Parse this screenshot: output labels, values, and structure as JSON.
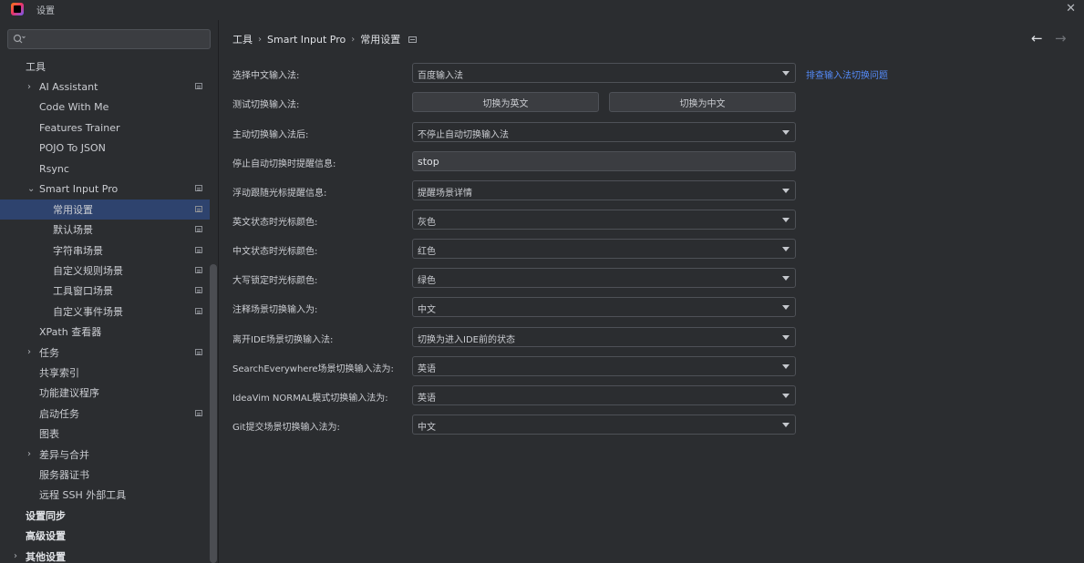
{
  "window": {
    "title": "设置",
    "close_label": "✕"
  },
  "search": {
    "value": "",
    "placeholder": ""
  },
  "sidebar": {
    "items": [
      {
        "label": "工具",
        "level": 0,
        "bold": false,
        "arrow": "",
        "icon": false,
        "selected": false
      },
      {
        "label": "AI Assistant",
        "level": 1,
        "arrow": "›",
        "icon": true,
        "selected": false
      },
      {
        "label": "Code With Me",
        "level": 1,
        "arrow": "",
        "icon": false,
        "selected": false
      },
      {
        "label": "Features Trainer",
        "level": 1,
        "arrow": "",
        "icon": false,
        "selected": false
      },
      {
        "label": "POJO To JSON",
        "level": 1,
        "arrow": "",
        "icon": false,
        "selected": false
      },
      {
        "label": "Rsync",
        "level": 1,
        "arrow": "",
        "icon": false,
        "selected": false
      },
      {
        "label": "Smart Input Pro",
        "level": 1,
        "arrow": "⌄",
        "icon": true,
        "selected": false
      },
      {
        "label": "常用设置",
        "level": 2,
        "arrow": "",
        "icon": true,
        "selected": true
      },
      {
        "label": "默认场景",
        "level": 2,
        "arrow": "",
        "icon": true,
        "selected": false
      },
      {
        "label": "字符串场景",
        "level": 2,
        "arrow": "",
        "icon": true,
        "selected": false
      },
      {
        "label": "自定义规则场景",
        "level": 2,
        "arrow": "",
        "icon": true,
        "selected": false
      },
      {
        "label": "工具窗口场景",
        "level": 2,
        "arrow": "",
        "icon": true,
        "selected": false
      },
      {
        "label": "自定义事件场景",
        "level": 2,
        "arrow": "",
        "icon": true,
        "selected": false
      },
      {
        "label": "XPath 查看器",
        "level": 1,
        "arrow": "",
        "icon": false,
        "selected": false
      },
      {
        "label": "任务",
        "level": 1,
        "arrow": "›",
        "icon": true,
        "selected": false
      },
      {
        "label": "共享索引",
        "level": 1,
        "arrow": "",
        "icon": false,
        "selected": false
      },
      {
        "label": "功能建议程序",
        "level": 1,
        "arrow": "",
        "icon": false,
        "selected": false
      },
      {
        "label": "启动任务",
        "level": 1,
        "arrow": "",
        "icon": true,
        "selected": false
      },
      {
        "label": "图表",
        "level": 1,
        "arrow": "",
        "icon": false,
        "selected": false
      },
      {
        "label": "差异与合并",
        "level": 1,
        "arrow": "›",
        "icon": false,
        "selected": false
      },
      {
        "label": "服务器证书",
        "level": 1,
        "arrow": "",
        "icon": false,
        "selected": false
      },
      {
        "label": "远程 SSH 外部工具",
        "level": 1,
        "arrow": "",
        "icon": false,
        "selected": false
      },
      {
        "label": "设置同步",
        "level": 0,
        "bold": true,
        "arrow": "",
        "icon": false,
        "selected": false
      },
      {
        "label": "高级设置",
        "level": 0,
        "bold": true,
        "arrow": "",
        "icon": false,
        "selected": false
      },
      {
        "label": "其他设置",
        "level": 0,
        "bold": true,
        "arrow": "›",
        "icon": false,
        "selected": false
      }
    ]
  },
  "breadcrumb": {
    "part1": "工具",
    "part2": "Smart Input Pro",
    "part3": "常用设置",
    "sep": "›"
  },
  "nav": {
    "back": "←",
    "forward": "→"
  },
  "form": {
    "ime": {
      "label": "选择中文输入法:",
      "value": "百度输入法",
      "link": "排查输入法切换问题"
    },
    "test": {
      "label": "测试切换输入法:",
      "btn_en": "切换为英文",
      "btn_zh": "切换为中文"
    },
    "after_manual": {
      "label": "主动切换输入法后:",
      "value": "不停止自动切换输入法"
    },
    "stop_tip": {
      "label": "停止自动切换时提醒信息:",
      "value": "stop"
    },
    "float_tip": {
      "label": "浮动跟随光标提醒信息:",
      "value": "提醒场景详情"
    },
    "en_color": {
      "label": "英文状态时光标颜色:",
      "value": "灰色"
    },
    "zh_color": {
      "label": "中文状态时光标颜色:",
      "value": "红色"
    },
    "caps_color": {
      "label": "大写锁定时光标颜色:",
      "value": "绿色"
    },
    "comment": {
      "label": "注释场景切换输入为:",
      "value": "中文"
    },
    "leave_ide": {
      "label": "离开IDE场景切换输入法:",
      "value": "切换为进入IDE前的状态"
    },
    "search_everywhere": {
      "label": "SearchEverywhere场景切换输入法为:",
      "value": "英语"
    },
    "ideavim": {
      "label": "IdeaVim NORMAL模式切换输入法为:",
      "value": "英语"
    },
    "git": {
      "label": "Git提交场景切换输入法为:",
      "value": "中文"
    }
  }
}
